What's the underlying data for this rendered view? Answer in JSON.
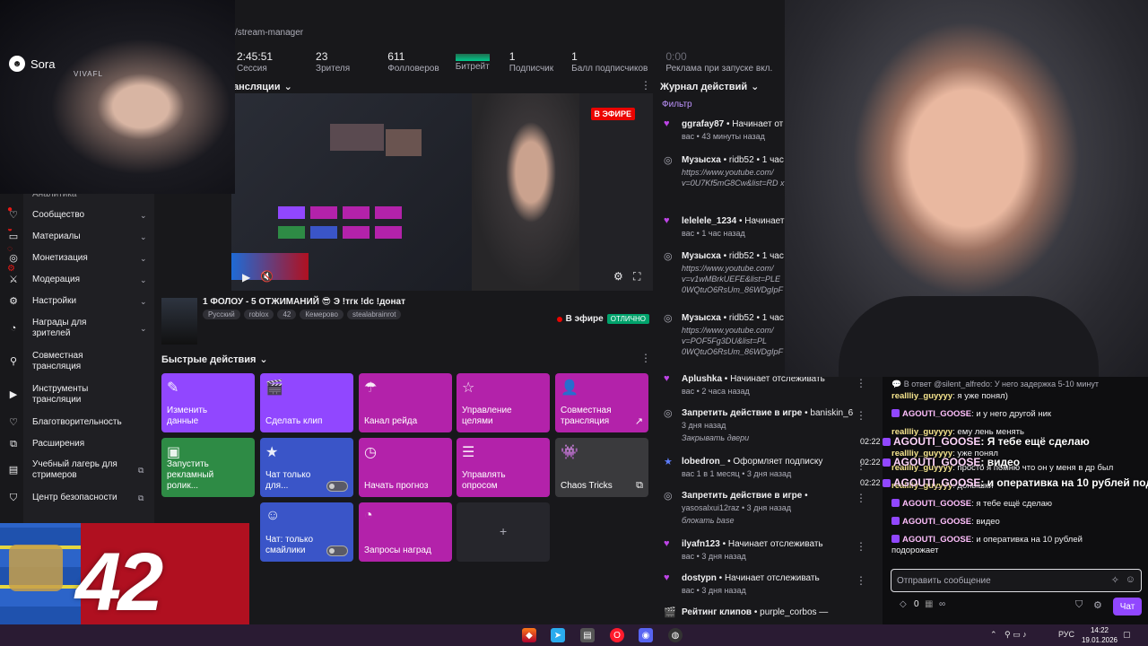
{
  "url": "/stream-manager",
  "stats": [
    {
      "value": "2:45:51",
      "label": "Сессия"
    },
    {
      "value": "23",
      "label": "Зрителя"
    },
    {
      "value": "611",
      "label": "Фолловеров"
    },
    {
      "value": "",
      "label": "Битрейт"
    },
    {
      "value": "1",
      "label": "Подписчик"
    },
    {
      "value": "1",
      "label": "Балл подписчиков"
    },
    {
      "value": "0:00",
      "label": "Реклама при запуске вкл."
    }
  ],
  "preview": {
    "section_label": "ансляции",
    "live_badge": "В ЭФИРЕ"
  },
  "stream": {
    "title": "1 ФОЛОУ - 5 ОТЖИМАНИЙ 😎 Э !тгк !dc !донат",
    "tags": [
      "Русский",
      "roblox",
      "42",
      "Кемерово",
      "stealabrainrot"
    ],
    "on_air": "В эфире",
    "quality": "ОТЛИЧНО"
  },
  "quick_actions": {
    "title": "Быстрые действия",
    "items": [
      {
        "label": "Изменить данные",
        "icon": "pencil-icon",
        "color": "purple"
      },
      {
        "label": "Сделать клип",
        "icon": "clip-icon",
        "color": "purple"
      },
      {
        "label": "Канал рейда",
        "icon": "raid-icon",
        "color": "magenta"
      },
      {
        "label": "Управление целями",
        "icon": "star-icon",
        "color": "magenta"
      },
      {
        "label": "Совместная трансляция",
        "icon": "add-user-icon",
        "color": "magenta"
      },
      {
        "label": "Запустить рекламный ролик...",
        "icon": "ad-icon",
        "color": "green"
      },
      {
        "label": "Чат только для...",
        "icon": "star-icon",
        "color": "blue"
      },
      {
        "label": "Начать прогноз",
        "icon": "prediction-icon",
        "color": "magenta"
      },
      {
        "label": "Управлять опросом",
        "icon": "poll-icon",
        "color": "magenta"
      },
      {
        "label": "Chaos Tricks",
        "icon": "chaos-icon",
        "color": "grey"
      },
      {
        "label": "Чат: только смайлики",
        "icon": "smile-icon",
        "color": "blue"
      },
      {
        "label": "Запросы наград",
        "icon": "reward-icon",
        "color": "magenta"
      }
    ]
  },
  "activity": {
    "title": "Журнал действий",
    "filter": "Фильтр",
    "items": [
      {
        "user": "ggrafay87",
        "text": " • Начинает от",
        "sub": "вас • 43 минуты назад",
        "icon": "heart-icon"
      },
      {
        "user": "Музысха",
        "text": " • ridb52 • 1 час",
        "sub": "https://www.youtube.com/ v=0U7Kf5mG8Cw&list=RD x=2",
        "icon": "music-icon"
      },
      {
        "user": "lelelele_1234",
        "text": " • Начинает",
        "sub": "вас • 1 час назад",
        "icon": "heart-icon"
      },
      {
        "user": "Музысха",
        "text": " • ridb52 • 1 час",
        "sub": "https://www.youtube.com/ v=v1wMBrkUEFE&list=PLE 0WQtuO6RsUm_86WDgIpF",
        "icon": "music-icon"
      },
      {
        "user": "Музысха",
        "text": " • ridb52 • 1 час",
        "sub": "https://www.youtube.com/ v=POF5Fg3DU&list=PL 0WQtuO6RsUm_86WDgIpF",
        "icon": "music-icon"
      },
      {
        "user": "Aplushka",
        "text": " • Начинает отслеживать",
        "sub": "вас • 2 часа назад",
        "icon": "heart-icon"
      },
      {
        "user": "Запретить действие в игре",
        "text": " • baniskin_6",
        "sub": "3 дня назад",
        "sub2": "Закрывать двери",
        "icon": "music-icon"
      },
      {
        "user": "lobedron_",
        "text": " • Оформляет подписку",
        "sub": "вас 1 в 1 месяц • 3 дня назад",
        "icon": "star-icon"
      },
      {
        "user": "Запретить действие в игре",
        "text": " •",
        "sub": "yasosalxui12raz • 3 дня назад",
        "sub2": "блокать base",
        "icon": "music-icon"
      },
      {
        "user": "ilyafn123",
        "text": " • Начинает отслеживать",
        "sub": "вас • 3 дня назад",
        "icon": "heart-icon"
      },
      {
        "user": "dostypn",
        "text": " • Начинает отслеживать",
        "sub": "вас • 3 дня назад",
        "icon": "heart-icon"
      },
      {
        "user": "Рейтинг клипов",
        "text": " • purple_corbos —",
        "sub": "",
        "icon": "clip-icon"
      }
    ]
  },
  "sidebar": {
    "items": [
      {
        "label": "Аналитика"
      },
      {
        "label": "Сообщество",
        "chev": true
      },
      {
        "label": "Материалы",
        "chev": true
      },
      {
        "label": "Монетизация",
        "chev": true
      },
      {
        "label": "Модерация",
        "chev": true
      },
      {
        "label": "Настройки",
        "chev": true
      },
      {
        "label": "Награды для зрителей",
        "chev": true
      },
      {
        "label": "Совместная трансляция"
      },
      {
        "label": "Инструменты трансляции"
      },
      {
        "label": "Благотворительность"
      },
      {
        "label": "Расширения"
      },
      {
        "label": "Учебный лагерь для стримеров"
      },
      {
        "label": "Центр безопасности"
      }
    ]
  },
  "overlay": {
    "sora": "Sora",
    "brand": "VIVAFL",
    "flag_number": "42"
  },
  "chat": {
    "reply": "В ответ @silent_alfredo: У него задержка 5-10 минут",
    "messages": [
      {
        "user": "reallliy_guyyyy",
        "text": ": я уже понял)"
      },
      {
        "user": "AGOUTI_GOOSE",
        "text": ": и у него другой ник"
      },
      {
        "user": "reallliy_guyyyy",
        "text": ": ему лень менять"
      },
      {
        "user": "reallliy_guyyyy",
        "text": ": уже понял"
      },
      {
        "user": "reallliy_guyyyy",
        "text": ": просто я помню что он у меня в др был"
      },
      {
        "user": "reallliy_guyyyy",
        "text": ": донышки"
      },
      {
        "user": "AGOUTI_GOOSE",
        "text": ": я тебе ещё сделаю"
      },
      {
        "user": "AGOUTI_GOOSE",
        "text": ": видео"
      },
      {
        "user": "AGOUTI_GOOSE",
        "text": ": и оперативка на 10 рублей подорожает"
      }
    ],
    "big": [
      {
        "ts": "02:22",
        "user": "AGOUTI_GOOSE",
        "text": ": Я тебе ещё сделаю"
      },
      {
        "ts": "02:22",
        "user": "AGOUTI_GOOSE",
        "text": ": видео"
      },
      {
        "ts": "02:22",
        "user": "AGOUTI_GOOSE",
        "text": ": и оперативка на 10 рублей подо"
      }
    ],
    "placeholder": "Отправить сообщение",
    "points": "0",
    "send": "Чат"
  },
  "taskbar": {
    "lang": "РУС",
    "time": "14:22",
    "date": "19.01.2026"
  }
}
